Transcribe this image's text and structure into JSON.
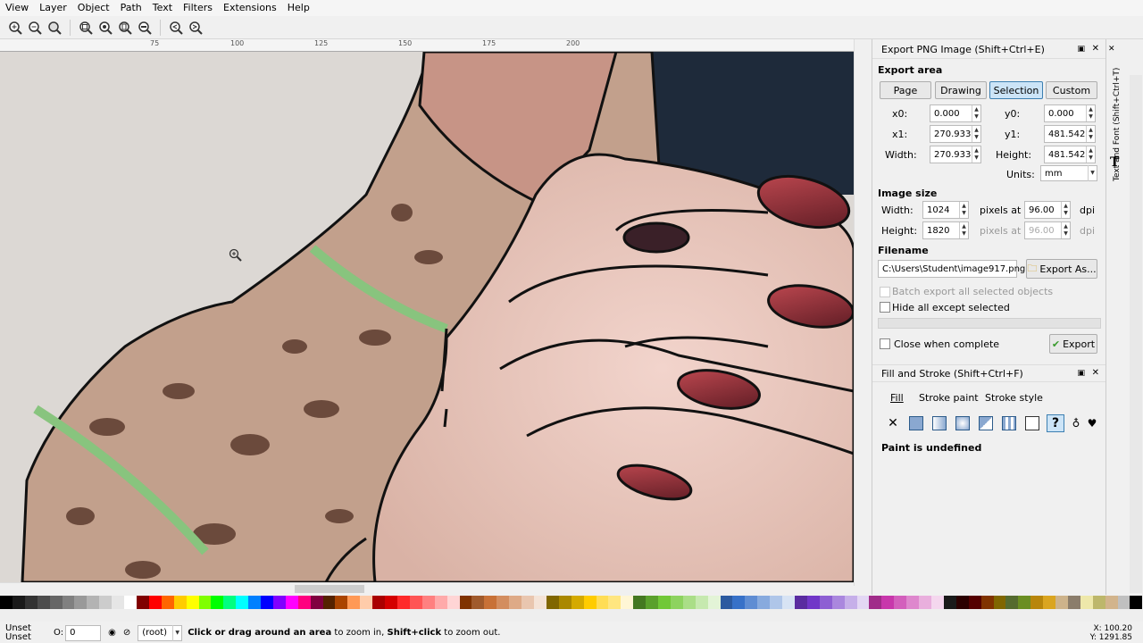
{
  "menu": [
    "View",
    "Layer",
    "Object",
    "Path",
    "Text",
    "Filters",
    "Extensions",
    "Help"
  ],
  "ruler_ticks": [
    "75",
    "100",
    "125",
    "150",
    "175",
    "200"
  ],
  "export": {
    "title": "Export PNG Image (Shift+Ctrl+E)",
    "area_label": "Export area",
    "area_buttons": [
      "Page",
      "Drawing",
      "Selection",
      "Custom"
    ],
    "x0_label": "x0:",
    "x0": "0.000",
    "y0_label": "y0:",
    "y0": "0.000",
    "x1_label": "x1:",
    "x1": "270.933",
    "y1_label": "y1:",
    "y1": "481.542",
    "width_label": "Width:",
    "width": "270.933",
    "height_label": "Height:",
    "height": "481.542",
    "units_label": "Units:",
    "units": "mm",
    "image_size_label": "Image size",
    "img_width_label": "Width:",
    "img_width": "1024",
    "img_height_label": "Height:",
    "img_height": "1820",
    "pixels_at": "pixels at",
    "dpi1": "96.00",
    "dpi2": "96.00",
    "dpi_unit": "dpi",
    "filename_label": "Filename",
    "filename": "C:\\Users\\Student\\image917.png",
    "export_as": "Export As...",
    "batch": "Batch export all selected objects",
    "hide_all": "Hide all except selected",
    "close_when": "Close when complete",
    "export_btn": "Export"
  },
  "fill": {
    "title": "Fill and Stroke (Shift+Ctrl+F)",
    "tabs": [
      "Fill",
      "Stroke paint",
      "Stroke style"
    ],
    "status": "Paint is undefined",
    "unknown_glyph": "?"
  },
  "right_tab": "Text and Font (Shift+Ctrl+T)",
  "status": {
    "fill": "Unset",
    "stroke": "Unset",
    "opacity_label": "O:",
    "opacity": "0",
    "layer": "(root)",
    "hint_b1": "Click or drag around an area",
    "hint_1": " to zoom in, ",
    "hint_b2": "Shift+click",
    "hint_2": " to zoom out.",
    "x": "X: 100.20",
    "y": "Y: 1291.85"
  },
  "palette": [
    "#000000",
    "#1a1a1a",
    "#333",
    "#4d4d4d",
    "#666",
    "#808080",
    "#999",
    "#b3b3b3",
    "#ccc",
    "#e6e6e6",
    "#fff",
    "#800000",
    "#ff0000",
    "#ff6600",
    "#ffcc00",
    "#ffff00",
    "#80ff00",
    "#00ff00",
    "#00ff80",
    "#00ffff",
    "#0080ff",
    "#0000ff",
    "#8000ff",
    "#ff00ff",
    "#ff0080",
    "#800040",
    "#552200",
    "#aa4400",
    "#ff9955",
    "#ffccaa",
    "#aa0000",
    "#d40000",
    "#ff2a2a",
    "#ff5555",
    "#ff8080",
    "#ffaaaa",
    "#ffd5d5",
    "#803300",
    "#a05a2c",
    "#c87137",
    "#d38d5f",
    "#deaa87",
    "#e9c6af",
    "#f4e3d7",
    "#806600",
    "#aa8800",
    "#d4aa00",
    "#ffcc00",
    "#ffdd55",
    "#ffe680",
    "#fff6d5",
    "#447821",
    "#5aa02c",
    "#71c837",
    "#8dd35f",
    "#aade87",
    "#c6e9af",
    "#e3f4d7",
    "#2c5aa0",
    "#3771c8",
    "#5f8dd3",
    "#87aade",
    "#afc6e9",
    "#d7e3f4",
    "#5a2ca0",
    "#7137c8",
    "#8d5fd3",
    "#aa87de",
    "#c6afe9",
    "#e3d7f4",
    "#a02c89",
    "#c837ab",
    "#d35fbc",
    "#de87cd",
    "#e9afdd",
    "#f4d7ee",
    "#1a1a1a",
    "#2b0000",
    "#550000",
    "#803300",
    "#806600",
    "#556b2f",
    "#6b8e23",
    "#b8860b",
    "#daa520",
    "#cdb38b",
    "#8b7d6b",
    "#eee8aa",
    "#bdb76b",
    "#d2b48c",
    "#c0c0c0",
    "#000"
  ]
}
